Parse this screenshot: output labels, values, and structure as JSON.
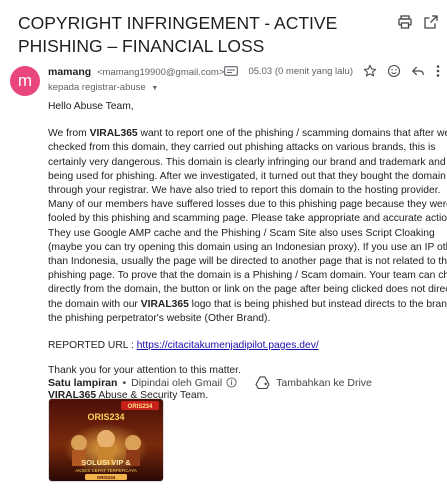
{
  "email": {
    "subject": "COPYRIGHT INFRINGEMENT - ACTIVE PHISHING – FINANCIAL LOSS",
    "sender": {
      "initial": "m",
      "name": "mamang",
      "email": "<mamang19900@gmail.com>",
      "avatar_color": "#e8467c"
    },
    "recipient_line": "kepada registrar-abuse",
    "time": "05.03 (0 menit yang lalu)",
    "body": {
      "greeting": "Hello Abuse Team,",
      "p1_a": "We from ",
      "p1_brand": "VIRAL365",
      "p1_b": " want to report one of the phishing / scamming domains that after we checked from this domain, they carried out phishing attacks on various brands, this is certainly very dangerous. This domain is clearly infringing our brand and trademark and is being used for phishing. After we investigated, it turned out that they bought the domain through your registrar. We have also tried to report this domain to the hosting provider. Many of our members have suffered losses due to this phishing page because they were fooled by this phishing and scamming page. Please take appropriate and accurate action. They use Google AMP cache and the Phishing / Scam Site also uses Script Cloaking (maybe you can try opening this domain using an Indonesian proxy). If you use an IP other than Indonesia, usually the page will be directed to another page that is not related to the phishing page. To prove that the domain is a Phishing / Scam domain. Your team can check directly from the domain, the button or link on the page after being clicked does not direct to the domain with our ",
      "p1_brand2": "VIRAL365",
      "p1_c": " logo that is being phished but instead directs to the brand of the phishing perpetrator's website (Other Brand).",
      "reported_label": "REPORTED URL : ",
      "reported_url": "https://citacitakumenjadipilot.pages.dev/",
      "thanks": "Thank you for your attention to this matter.",
      "sig_brand": "VIRAL365",
      "sig_rest": " Abuse & Security Team."
    },
    "attachments": {
      "title": "Satu lampiran",
      "sep": "•",
      "scanned": "Dipindai oleh Gmail",
      "add_drive": "Tambahkan ke Drive",
      "thumb_text": [
        "ORIS234",
        "ORIS234",
        "SOLUSI VIP &",
        "AKSES CEPAT TERPERCAYA",
        "ORIS234"
      ]
    },
    "icons": [
      "print-icon",
      "open-new-window-icon",
      "label-icon",
      "star-icon",
      "emoji-icon",
      "reply-icon",
      "more-icon",
      "chevron-down-icon",
      "info-icon",
      "add-to-drive-icon"
    ]
  }
}
